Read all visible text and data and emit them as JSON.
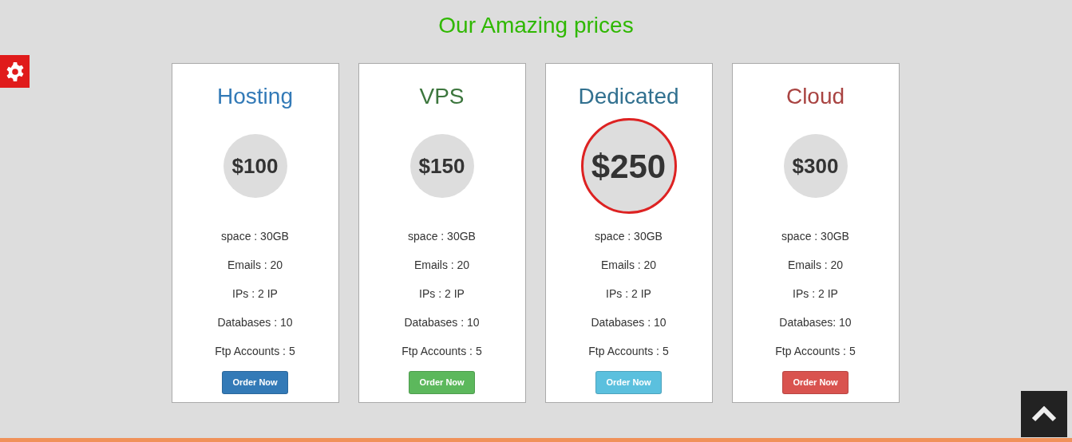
{
  "heading": "Our Amazing prices",
  "plans": [
    {
      "title": "Hosting",
      "kind": "primary",
      "price": "$100",
      "selected": false,
      "features": [
        "space : 30GB",
        "Emails : 20",
        "IPs : 2 IP",
        "Databases : 10",
        "Ftp Accounts : 5"
      ],
      "button": "Order Now"
    },
    {
      "title": "VPS",
      "kind": "success",
      "price": "$150",
      "selected": false,
      "features": [
        "space : 30GB",
        "Emails : 20",
        "IPs : 2 IP",
        "Databases : 10",
        "Ftp Accounts : 5"
      ],
      "button": "Order Now"
    },
    {
      "title": "Dedicated",
      "kind": "info",
      "price": "$250",
      "selected": true,
      "features": [
        "space : 30GB",
        "Emails : 20",
        "IPs : 2 IP",
        "Databases : 10",
        "Ftp Accounts : 5"
      ],
      "button": "Order Now"
    },
    {
      "title": "Cloud",
      "kind": "danger",
      "price": "$300",
      "selected": false,
      "features": [
        "space : 30GB",
        "Emails : 20",
        "IPs : 2 IP",
        "Databases: 10",
        "Ftp Accounts : 5"
      ],
      "button": "Order Now"
    }
  ]
}
